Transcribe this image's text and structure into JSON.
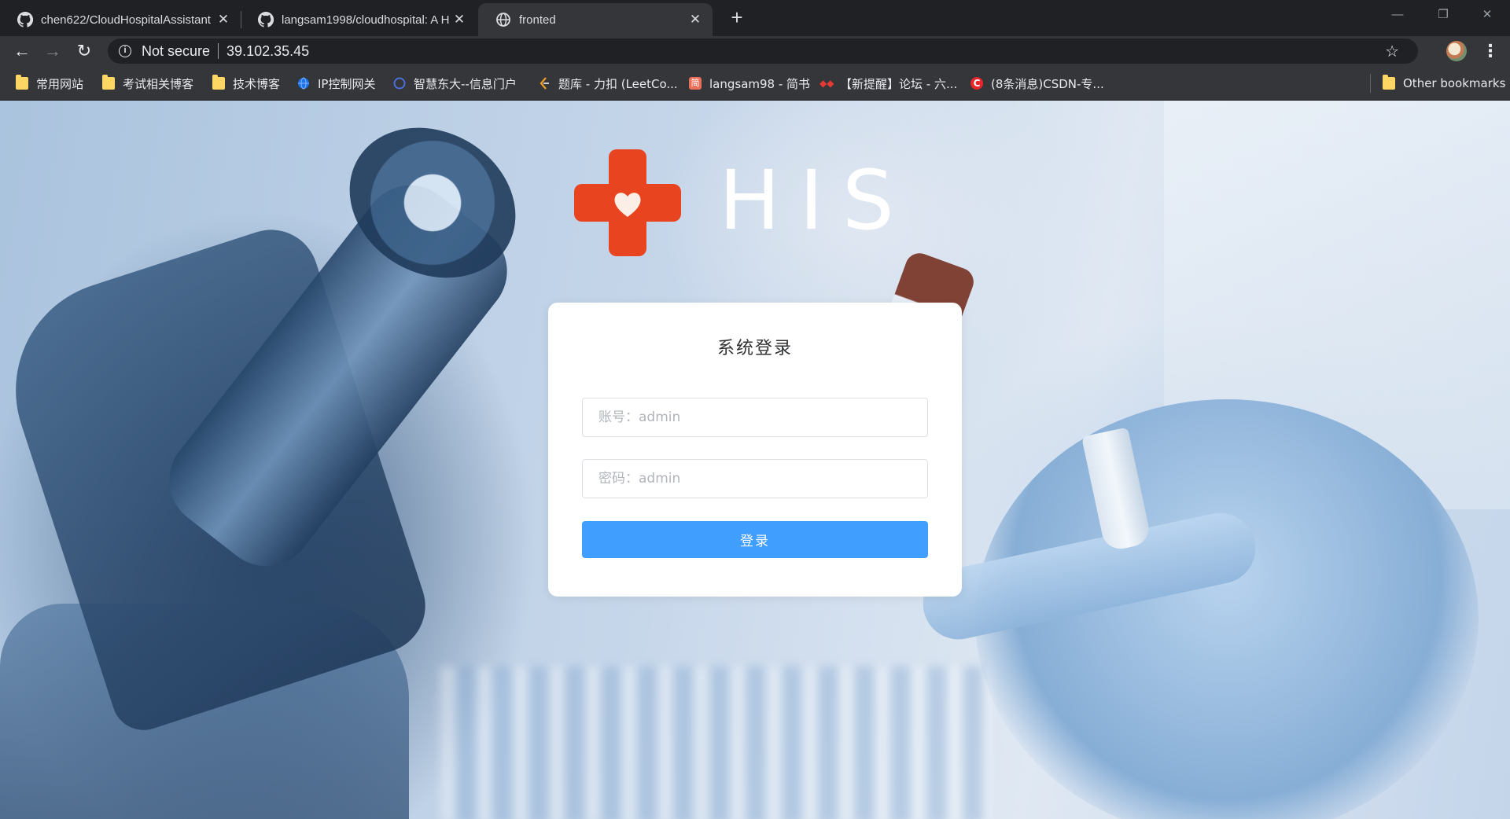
{
  "browser": {
    "tabs": [
      {
        "title": "chen622/CloudHospitalAssistant",
        "icon": "github-icon",
        "close": "✕"
      },
      {
        "title": "langsam1998/cloudhospital: A H",
        "icon": "github-icon",
        "close": "✕"
      },
      {
        "title": "fronted",
        "icon": "globe-icon",
        "close": "✕"
      }
    ],
    "new_tab": "+",
    "window_controls": {
      "minimize": "—",
      "restore": "❐",
      "close": "✕"
    },
    "nav": {
      "back": "←",
      "forward": "→",
      "reload": "↻"
    },
    "omnibox": {
      "security_label": "Not secure",
      "url": "39.102.35.45",
      "info": "i",
      "star": "☆"
    },
    "menu": "⋮",
    "bookmarks": [
      {
        "label": "常用网站",
        "icon": "folder-icon"
      },
      {
        "label": "考试相关博客",
        "icon": "folder-icon"
      },
      {
        "label": "技术博客",
        "icon": "folder-icon"
      },
      {
        "label": "IP控制网关",
        "icon": "globe-icon"
      },
      {
        "label": "智慧东大--信息门户",
        "icon": "university-icon"
      },
      {
        "label": "题库 - 力扣 (LeetCo...",
        "icon": "leetcode-icon"
      },
      {
        "label": "langsam98 - 简书",
        "icon": "jianshu-icon"
      },
      {
        "label": "【新提醒】论坛 - 六...",
        "icon": "forum-icon"
      },
      {
        "label": "(8条消息)CSDN-专...",
        "icon": "csdn-icon"
      }
    ],
    "other_bookmarks": "Other bookmarks"
  },
  "page": {
    "logo_text": "HIS",
    "login": {
      "title": "系统登录",
      "username_placeholder": "账号：admin",
      "password_placeholder": "密码：admin",
      "submit_label": "登录"
    }
  },
  "colors": {
    "accent": "#409eff",
    "logo_red": "#e8441f",
    "chrome_dark": "#202124",
    "chrome_toolbar": "#35363a"
  }
}
